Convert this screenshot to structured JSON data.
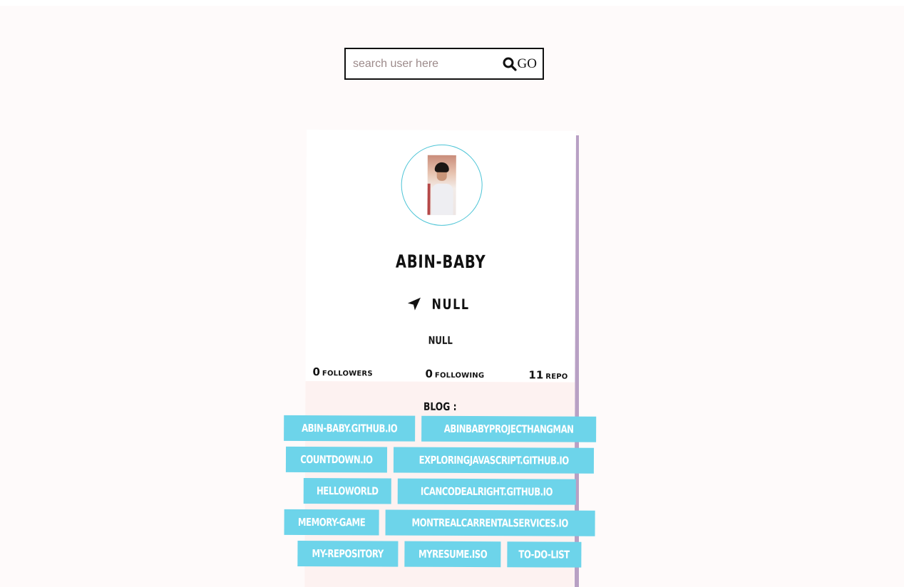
{
  "search": {
    "placeholder": "search user here",
    "value": "",
    "button_label": "GO",
    "icon": "search-icon"
  },
  "profile": {
    "username": "ABIN-BABY",
    "location": "NULL",
    "location_icon": "location-arrow-icon",
    "bio": "NULL",
    "accent_color": "#4cc4d6",
    "stats": {
      "followers_count": "0",
      "followers_label": "FOLLOWERS",
      "following_count": "0",
      "following_label": "FOLLOWING",
      "repos_count": "11",
      "repos_label": "REPO"
    }
  },
  "repos_section": {
    "label": "BLOG :",
    "chip_color": "#6dd4ea",
    "rows": [
      [
        "ABIN-BABY.GITHUB.IO",
        "ABINBABYPROJECTHANGMAN"
      ],
      [
        "COUNTDOWN.IO",
        "EXPLORINGJAVASCRIPT.GITHUB.IO"
      ],
      [
        "HELLOWORLD",
        "ICANCODEALRIGHT.GITHUB.IO"
      ],
      [
        "MEMORY-GAME",
        "MONTREALCARRENTALSERVICES.IO"
      ],
      [
        "MY-REPOSITORY",
        "MYRESUME.ISO",
        "TO-DO-LIST"
      ]
    ]
  }
}
